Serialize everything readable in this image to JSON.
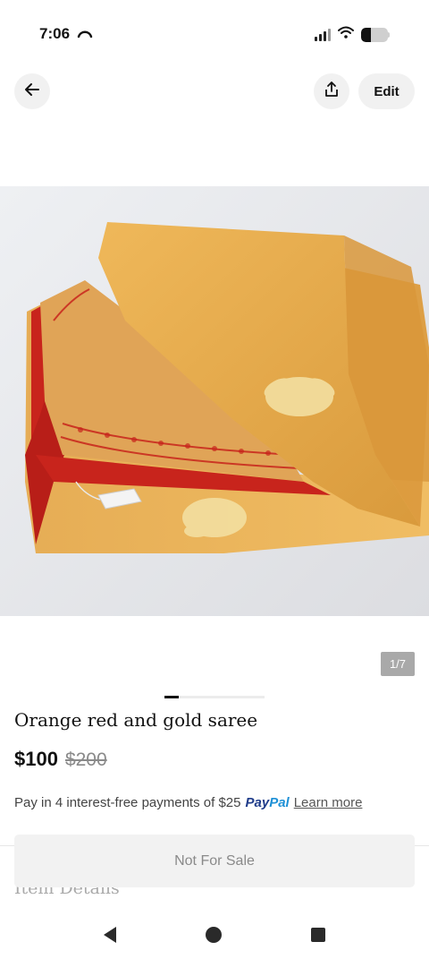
{
  "status_bar": {
    "time": "7:06",
    "icons": [
      "missed-call-icon",
      "signal-icon",
      "wifi-icon",
      "battery-icon"
    ]
  },
  "nav": {
    "back_icon": "arrow-left-icon",
    "share_icon": "share-icon",
    "edit_label": "Edit"
  },
  "gallery": {
    "counter": "1/7",
    "total_images": 7,
    "current_index": 1
  },
  "product": {
    "title": "Orange red and gold saree",
    "price": "$100",
    "original_price": "$200",
    "paypal_text": "Pay in 4 interest-free payments of $25",
    "paypal_brand_pay": "Pay",
    "paypal_brand_pal": "Pal",
    "paypal_link": "Learn more",
    "next_section": "Item Details"
  },
  "actions": {
    "not_for_sale_label": "Not For Sale"
  },
  "system_nav": {
    "back": "triangle-back-icon",
    "home": "circle-home-icon",
    "recents": "square-recents-icon"
  },
  "colors": {
    "paypal_dark": "#1f3c8a",
    "paypal_light": "#1e90d6",
    "saree_gold": "#e3a84c",
    "saree_red": "#c8241c"
  }
}
